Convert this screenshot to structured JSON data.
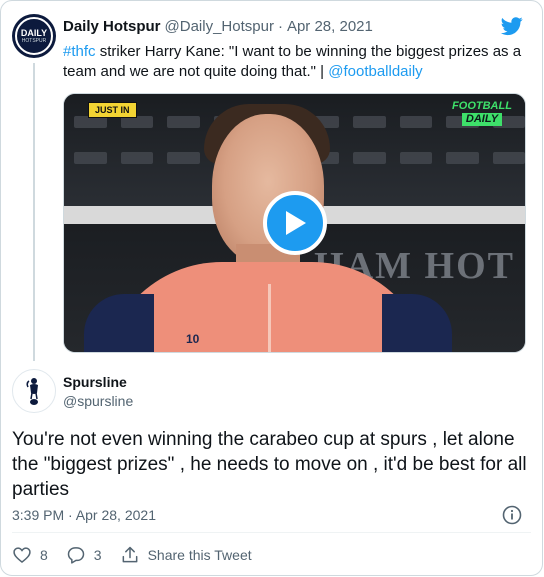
{
  "parent_tweet": {
    "author_name": "Daily Hotspur",
    "handle": "@Daily_Hotspur",
    "separator": "·",
    "date": "Apr 28, 2021",
    "avatar": {
      "line1": "DAILY",
      "line2": "HOTSPUR"
    },
    "text_hashtag": "#thfc",
    "text_body": " striker Harry Kane: \"I want to be winning the biggest prizes as a team and we are not quite doing that.\" | ",
    "text_mention": "@footballdaily",
    "media": {
      "badge_left": "JUST IN",
      "badge_right_line1": "FOOTBALL",
      "badge_right_line2": "DAILY",
      "background_letters": "HAM HOT",
      "shirt_number": "10",
      "play_icon": "play-icon"
    }
  },
  "reply_tweet": {
    "author_name": "Spursline",
    "handle": "@spursline",
    "text": "You're not even winning the carabeo cup at spurs  , let alone the \"biggest prizes\" , he needs to move on , it'd be best for all parties",
    "timestamp": "3:39 PM · Apr 28, 2021",
    "actions": {
      "like_count": "8",
      "reply_count": "3",
      "share_label": "Share this Tweet"
    }
  },
  "icons": {
    "brand": "twitter-bird-icon",
    "info": "info-icon",
    "like": "heart-icon",
    "reply": "comment-icon",
    "share": "share-icon"
  },
  "colors": {
    "link": "#1d9bf0",
    "text_primary": "#0f1419",
    "text_secondary": "#536471",
    "border": "#cfd9de"
  }
}
